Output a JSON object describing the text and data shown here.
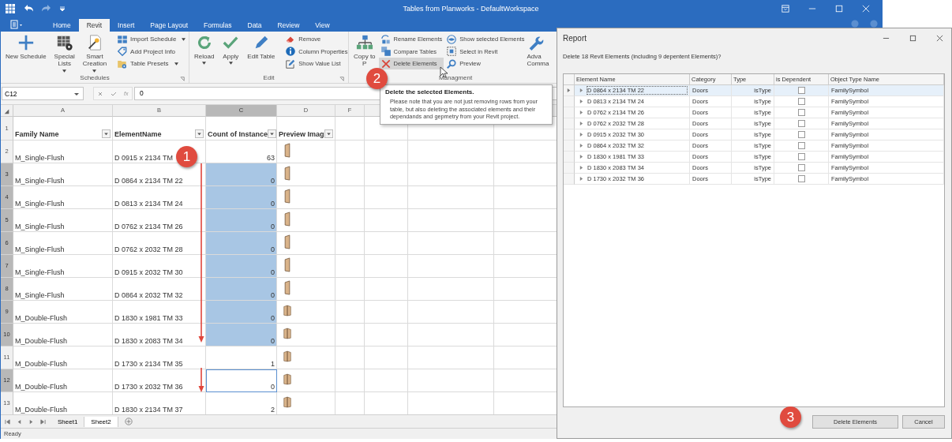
{
  "window": {
    "title": "Tables from Planworks - DefaultWorkspace"
  },
  "ribbon_tabs": [
    {
      "label": "Home",
      "selected": false
    },
    {
      "label": "Revit",
      "selected": true
    },
    {
      "label": "Insert",
      "selected": false
    },
    {
      "label": "Page Layout",
      "selected": false
    },
    {
      "label": "Formulas",
      "selected": false
    },
    {
      "label": "Data",
      "selected": false
    },
    {
      "label": "Review",
      "selected": false
    },
    {
      "label": "View",
      "selected": false
    }
  ],
  "ribbon_groups": [
    {
      "label": "Schedules",
      "launcher": true,
      "large": [
        {
          "lines": [
            "New Schedule"
          ],
          "dropdown": false
        },
        {
          "lines": [
            "Special",
            "Lists"
          ],
          "dropdown": true
        },
        {
          "lines": [
            "Smart",
            "Creation"
          ],
          "dropdown": true
        }
      ],
      "small_columns": [
        [
          {
            "label": "Import Schedule",
            "dropdown": true,
            "hovered": false
          },
          {
            "label": "Add Project Info",
            "dropdown": false,
            "hovered": false
          },
          {
            "label": "Table Presets",
            "dropdown": true,
            "hovered": false
          }
        ]
      ]
    },
    {
      "label": "Edit",
      "launcher": true,
      "large": [
        {
          "lines": [
            "Reload"
          ],
          "dropdown": true
        },
        {
          "lines": [
            "Apply"
          ],
          "dropdown": true
        },
        {
          "lines": [
            "Edit Table"
          ],
          "dropdown": false
        }
      ],
      "small_columns": [
        [
          {
            "label": "Remove",
            "dropdown": false,
            "hovered": false
          },
          {
            "label": "Column Properties",
            "dropdown": false,
            "hovered": false
          },
          {
            "label": "Show Value List",
            "dropdown": false,
            "hovered": false
          }
        ]
      ]
    },
    {
      "label": "Managment",
      "launcher": false,
      "large": [
        {
          "lines": [
            "Copy to",
            "P"
          ],
          "dropdown": false
        }
      ],
      "small_columns": [
        [
          {
            "label": "Rename Elements",
            "dropdown": false,
            "hovered": false
          },
          {
            "label": "Compare Tables",
            "dropdown": false,
            "hovered": false
          },
          {
            "label": "Delete Elements",
            "dropdown": false,
            "hovered": true
          }
        ],
        [
          {
            "label": "Show selected Elements",
            "dropdown": false,
            "hovered": false
          },
          {
            "label": "Select in Revit",
            "dropdown": false,
            "hovered": false
          },
          {
            "label": "Preview",
            "dropdown": false,
            "hovered": false
          }
        ]
      ],
      "trailing": [
        {
          "lines": [
            "Adva",
            "Comma"
          ],
          "dropdown": false
        }
      ]
    }
  ],
  "formula_bar": {
    "name_box": "C12",
    "fx_label": "fx",
    "value": "0"
  },
  "sheet": {
    "columns": [
      {
        "label": "A",
        "selected": false
      },
      {
        "label": "B",
        "selected": false
      },
      {
        "label": "C",
        "selected": true
      },
      {
        "label": "D",
        "selected": false
      },
      {
        "label": "F",
        "selected": false
      }
    ],
    "header": {
      "number": "1",
      "cells": [
        "Family Name",
        "ElementName",
        "Count of Instance",
        "Preview Imag"
      ]
    },
    "rows": [
      {
        "number": "2",
        "selected": false,
        "family": "M_Single-Flush",
        "element": "D 0915 x 2134 TM",
        "count": "63",
        "highlighted": false,
        "active": false,
        "kind": "single"
      },
      {
        "number": "3",
        "selected": true,
        "family": "M_Single-Flush",
        "element": "D 0864 x 2134 TM 22",
        "count": "0",
        "highlighted": true,
        "active": false,
        "kind": "single"
      },
      {
        "number": "4",
        "selected": true,
        "family": "M_Single-Flush",
        "element": "D 0813 x 2134 TM 24",
        "count": "0",
        "highlighted": true,
        "active": false,
        "kind": "single"
      },
      {
        "number": "5",
        "selected": true,
        "family": "M_Single-Flush",
        "element": "D 0762 x 2134 TM 26",
        "count": "0",
        "highlighted": true,
        "active": false,
        "kind": "single"
      },
      {
        "number": "6",
        "selected": true,
        "family": "M_Single-Flush",
        "element": "D 0762 x 2032 TM 28",
        "count": "0",
        "highlighted": true,
        "active": false,
        "kind": "single"
      },
      {
        "number": "7",
        "selected": true,
        "family": "M_Single-Flush",
        "element": "D 0915 x 2032 TM 30",
        "count": "0",
        "highlighted": true,
        "active": false,
        "kind": "single"
      },
      {
        "number": "8",
        "selected": true,
        "family": "M_Single-Flush",
        "element": "D 0864 x 2032 TM 32",
        "count": "0",
        "highlighted": true,
        "active": false,
        "kind": "single"
      },
      {
        "number": "9",
        "selected": true,
        "family": "M_Double-Flush",
        "element": "D 1830 x 1981 TM 33",
        "count": "0",
        "highlighted": true,
        "active": false,
        "kind": "double"
      },
      {
        "number": "10",
        "selected": true,
        "family": "M_Double-Flush",
        "element": "D 1830 x 2083 TM 34",
        "count": "0",
        "highlighted": true,
        "active": false,
        "kind": "double"
      },
      {
        "number": "11",
        "selected": false,
        "family": "M_Double-Flush",
        "element": "D 1730 x 2134 TM 35",
        "count": "1",
        "highlighted": false,
        "active": false,
        "kind": "double"
      },
      {
        "number": "12",
        "selected": true,
        "family": "M_Double-Flush",
        "element": "D 1730 x 2032 TM 36",
        "count": "0",
        "highlighted": false,
        "active": true,
        "kind": "double"
      },
      {
        "number": "13",
        "selected": false,
        "family": "M_Double-Flush",
        "element": "D 1830 x 2134 TM 37",
        "count": "2",
        "highlighted": false,
        "active": false,
        "kind": "double"
      }
    ],
    "tabs": [
      {
        "label": "Sheet1",
        "selected": false
      },
      {
        "label": "Sheet2",
        "selected": true
      }
    ]
  },
  "status_bar": "Ready",
  "tooltip": {
    "title": "Delete the selected Elements.",
    "body": "Please note that you are not just removing rows from your table, but also deleting the associated elements and their dependands and gepmetry from your Revit project."
  },
  "callouts": [
    "1",
    "2",
    "3"
  ],
  "dialog": {
    "title": "Report",
    "message": "Delete 18 Revit Elements (including 9 depentent Elements)?",
    "columns": [
      "Element Name",
      "Category",
      "Type",
      "is Dependent",
      "Object Type Name"
    ],
    "rows": [
      {
        "name": "D 0864 x 2134 TM 22",
        "category": "Doors",
        "type": "isType",
        "dependent": false,
        "object_type": "FamilySymbol",
        "selected": true
      },
      {
        "name": "D 0813 x 2134 TM 24",
        "category": "Doors",
        "type": "isType",
        "dependent": false,
        "object_type": "FamilySymbol",
        "selected": false
      },
      {
        "name": "D 0762 x 2134 TM 26",
        "category": "Doors",
        "type": "isType",
        "dependent": false,
        "object_type": "FamilySymbol",
        "selected": false
      },
      {
        "name": "D 0762 x 2032 TM 28",
        "category": "Doors",
        "type": "isType",
        "dependent": false,
        "object_type": "FamilySymbol",
        "selected": false
      },
      {
        "name": "D 0915 x 2032 TM 30",
        "category": "Doors",
        "type": "isType",
        "dependent": false,
        "object_type": "FamilySymbol",
        "selected": false
      },
      {
        "name": "D 0864 x 2032 TM 32",
        "category": "Doors",
        "type": "isType",
        "dependent": false,
        "object_type": "FamilySymbol",
        "selected": false
      },
      {
        "name": "D 1830 x 1981 TM 33",
        "category": "Doors",
        "type": "isType",
        "dependent": false,
        "object_type": "FamilySymbol",
        "selected": false
      },
      {
        "name": "D 1830 x 2083 TM 34",
        "category": "Doors",
        "type": "isType",
        "dependent": false,
        "object_type": "FamilySymbol",
        "selected": false
      },
      {
        "name": "D 1730 x 2032 TM 36",
        "category": "Doors",
        "type": "isType",
        "dependent": false,
        "object_type": "FamilySymbol",
        "selected": false
      }
    ],
    "buttons": [
      "Delete Elements",
      "Cancel"
    ]
  }
}
